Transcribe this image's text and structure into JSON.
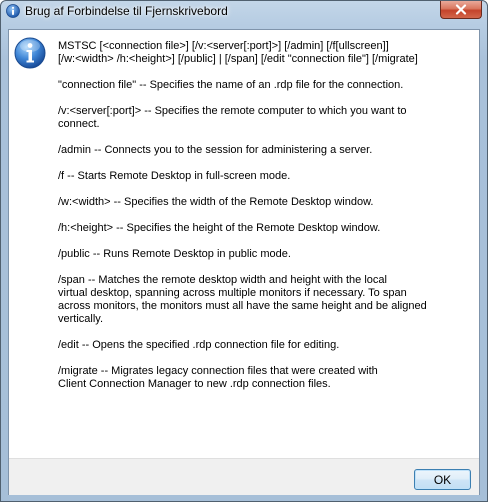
{
  "window": {
    "title": "Brug af Forbindelse til Fjernskrivebord",
    "title_icon": "info-icon",
    "close_icon": "close-icon"
  },
  "message": {
    "icon": "info-icon",
    "paragraphs": [
      "MSTSC [<connection file>] [/v:<server[:port]>] [/admin] [/f[ullscreen]]\n[/w:<width> /h:<height>] [/public] | [/span] [/edit \"connection file\"] [/migrate]",
      "\"connection file\" -- Specifies the name of an .rdp file for the connection.",
      "/v:<server[:port]> -- Specifies the remote computer to which you want to\nconnect.",
      "/admin -- Connects you to the session for administering a server.",
      "/f -- Starts Remote Desktop in full-screen mode.",
      "/w:<width> -- Specifies the width of the Remote Desktop window.",
      "/h:<height> -- Specifies the height of the Remote Desktop window.",
      "/public -- Runs Remote Desktop in public mode.",
      "/span -- Matches the remote desktop width and height with the local\nvirtual desktop, spanning across multiple monitors if necessary. To span\nacross monitors, the monitors must all have the same height and be aligned\nvertically.",
      "/edit -- Opens the specified .rdp connection file for editing.",
      "/migrate -- Migrates legacy connection files that were created with\nClient Connection Manager to new .rdp connection files."
    ]
  },
  "buttons": {
    "ok_label": "OK"
  },
  "colors": {
    "title_bar": "#b7cde3",
    "close_button": "#c4432b",
    "info_icon": "#1f5fb4",
    "button_strip": "#f0f0f0"
  }
}
